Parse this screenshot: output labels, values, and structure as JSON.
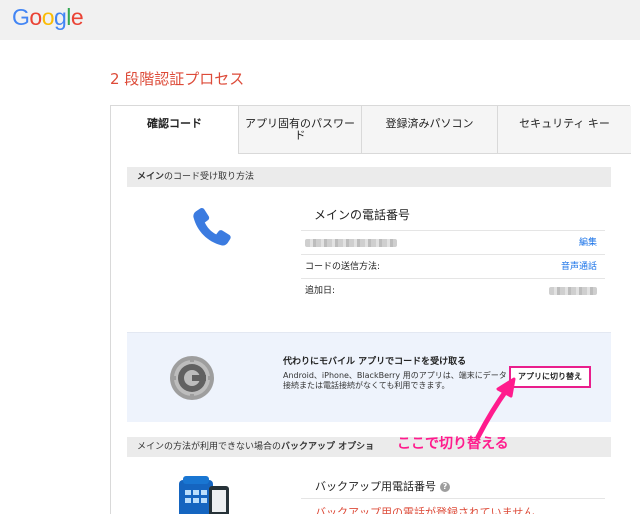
{
  "header": {
    "logo_letters": [
      {
        "ch": "G",
        "color": "#4285F4"
      },
      {
        "ch": "o",
        "color": "#EA4335"
      },
      {
        "ch": "o",
        "color": "#FBBC05"
      },
      {
        "ch": "g",
        "color": "#4285F4"
      },
      {
        "ch": "l",
        "color": "#34A853"
      },
      {
        "ch": "e",
        "color": "#EA4335"
      }
    ]
  },
  "page": {
    "title": "2 段階認証プロセス"
  },
  "tabs": [
    {
      "label": "確認コード",
      "active": true
    },
    {
      "label": "アプリ固有のパスワード",
      "active": false
    },
    {
      "label": "登録済みパソコン",
      "active": false
    },
    {
      "label": "セキュリティ キー",
      "active": false
    }
  ],
  "main_section": {
    "heading_bold": "メイン",
    "heading_rest": "のコード受け取り方法",
    "phone_title": "メインの電話番号",
    "edit_link": "編集",
    "send_method_label": "コードの送信方法:",
    "send_method_value": "音声通話",
    "added_date_label": "追加日:"
  },
  "alternative": {
    "title": "代わりにモバイル アプリでコードを受け取る",
    "description": "Android、iPhone、BlackBerry 用のアプリは、端末にデータ接続または電話接続がなくても利用できます。",
    "switch_button": "アプリに切り替え"
  },
  "backup_section": {
    "heading_rest": "メインの方法が利用できない場合の",
    "heading_bold": "バックアップ オプショ",
    "phone_title": "バックアップ用電話番号",
    "help_glyph": "?",
    "warning": "バックアップ用の電話が登録されていません"
  },
  "annotation": {
    "text": "ここで切り替える",
    "color": "#ff1b8d"
  },
  "colors": {
    "title_red": "#dd4b39",
    "link_blue": "#1a73e8",
    "highlight_pink": "#e91e8c"
  }
}
